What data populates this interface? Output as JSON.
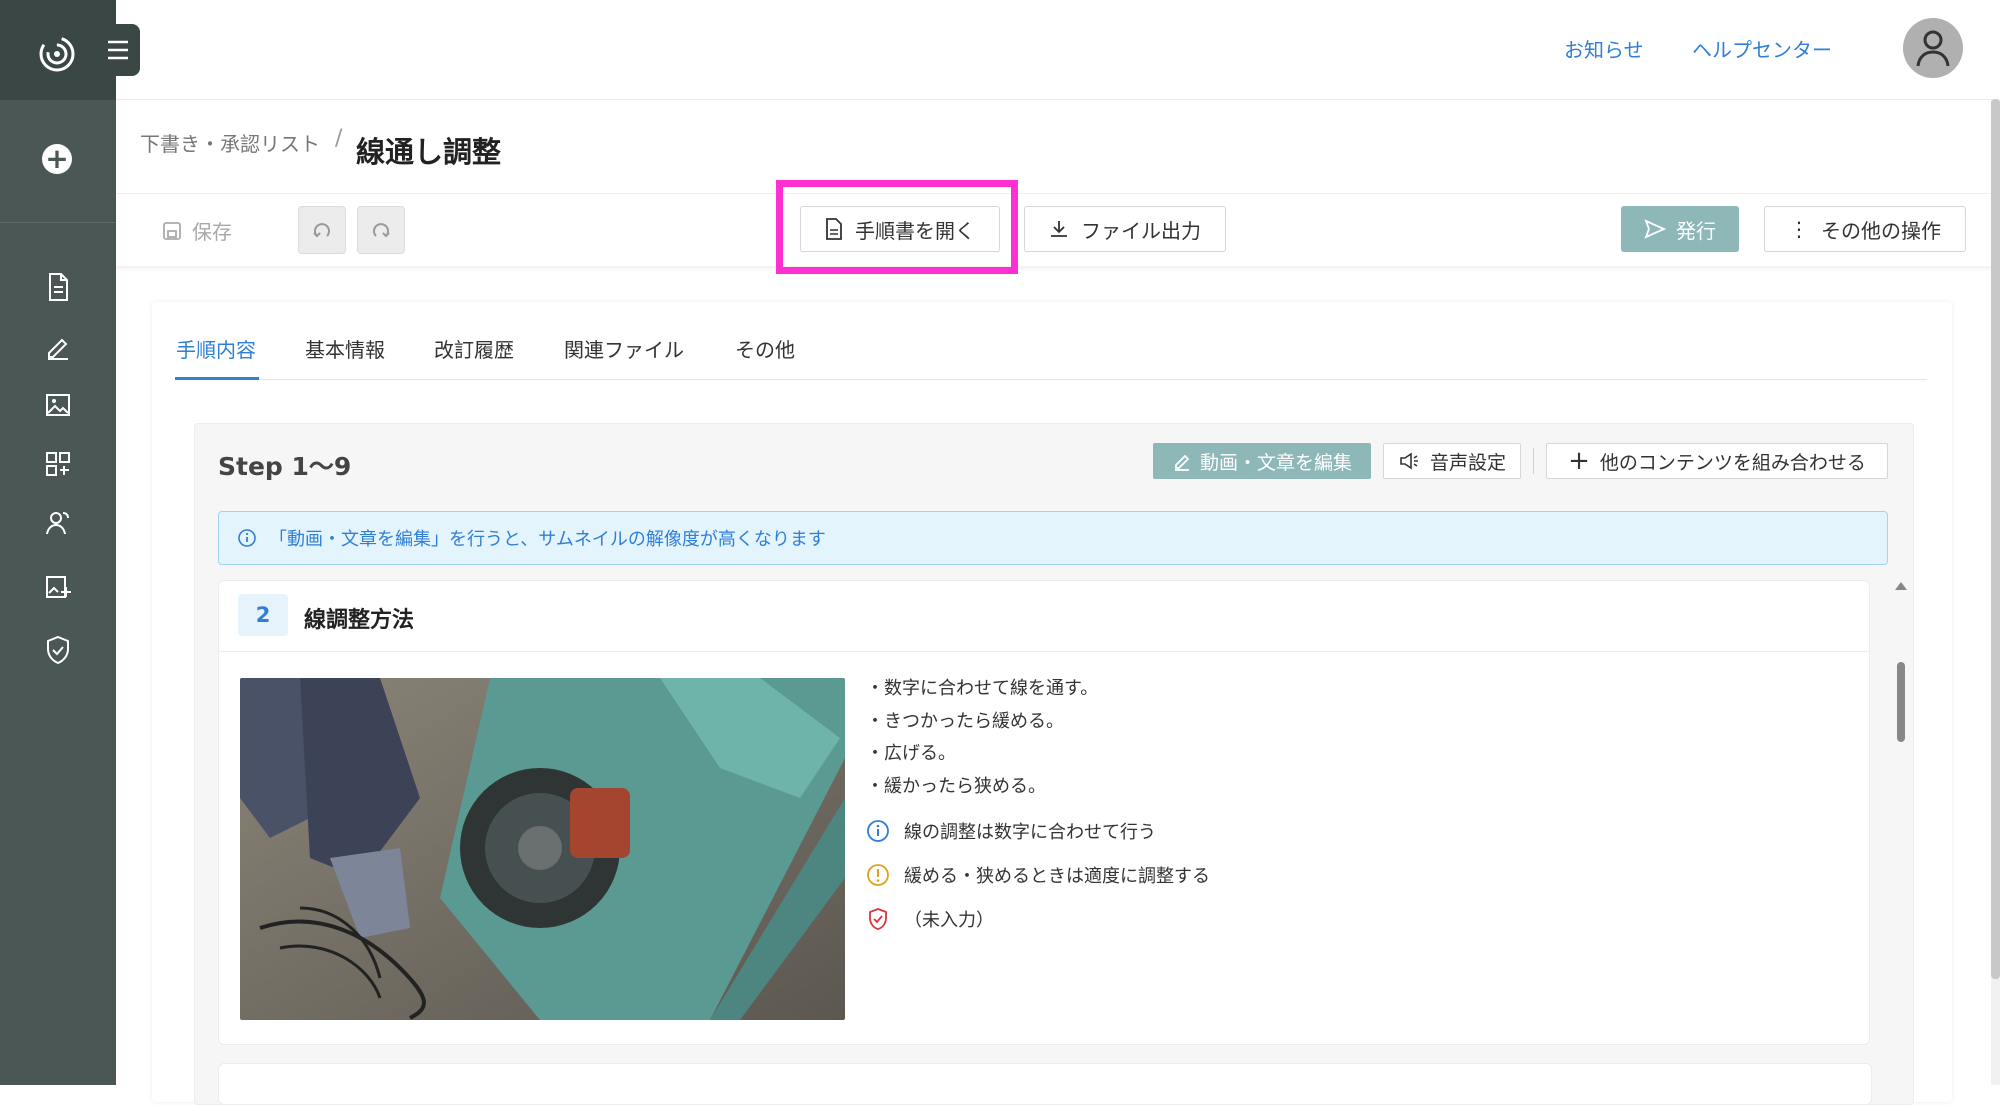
{
  "header": {
    "links": [
      "お知らせ",
      "ヘルプセンター"
    ]
  },
  "breadcrumb": {
    "parent": "下書き・承認リスト",
    "separator": "/",
    "title": "線通し調整"
  },
  "toolbar": {
    "save_label": "保存",
    "open_manual_label": "手順書を開く",
    "export_label": "ファイル出力",
    "publish_label": "発行",
    "more_label": "その他の操作"
  },
  "tabs": [
    {
      "label": "手順内容",
      "active": true
    },
    {
      "label": "基本情報",
      "active": false
    },
    {
      "label": "改訂履歴",
      "active": false
    },
    {
      "label": "関連ファイル",
      "active": false
    },
    {
      "label": "その他",
      "active": false
    }
  ],
  "step_panel": {
    "title": "Step 1〜9",
    "edit_label": "動画・文章を編集",
    "audio_label": "音声設定",
    "combine_label": "他のコンテンツを組み合わせる",
    "info_message": "「動画・文章を編集」を行うと、サムネイルの解像度が高くなります"
  },
  "step_card": {
    "number": "2",
    "title": "線調整方法",
    "bullets": [
      "・数字に合わせて線を通す。",
      "・きつかったら緩める。",
      "・広げる。",
      "・緩かったら狭める。"
    ],
    "notes": [
      {
        "type": "info",
        "icon": "info-icon",
        "text": "線の調整は数字に合わせて行う"
      },
      {
        "type": "warning",
        "icon": "warning-icon",
        "text": "緩める・狭めるときは適度に調整する"
      },
      {
        "type": "safety",
        "icon": "shield-check-icon",
        "text": "（未入力）"
      }
    ]
  },
  "colors": {
    "sidebar": "#4a5755",
    "accent": "#2f7fd6",
    "highlight": "#ff2fd2",
    "teal_button": "#8eb7b7"
  }
}
